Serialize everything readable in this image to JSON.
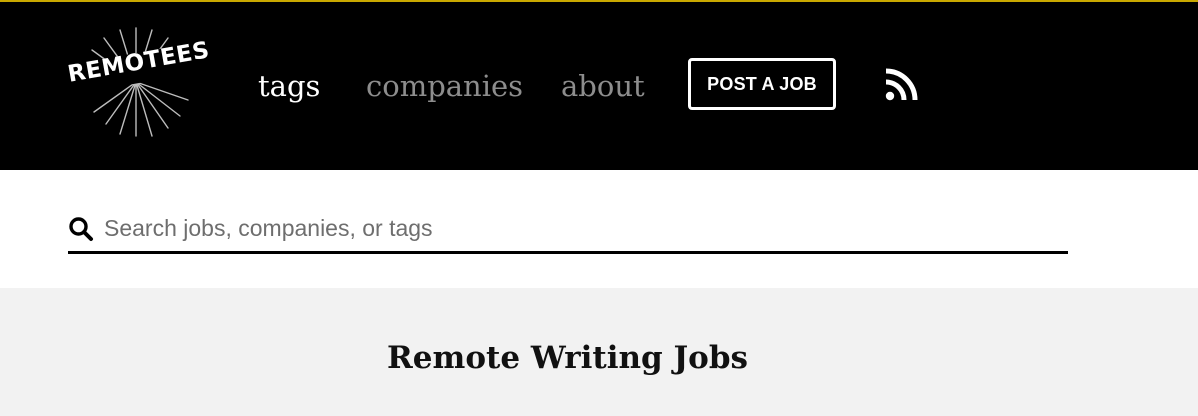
{
  "header": {
    "logo_text": "REMOTEES",
    "nav": [
      {
        "label": "tags"
      },
      {
        "label": "companies"
      },
      {
        "label": "about"
      }
    ],
    "post_job_label": "POST A JOB",
    "rss_icon": "rss-icon"
  },
  "search": {
    "placeholder": "Search jobs, companies, or tags",
    "value": "",
    "icon": "search-icon"
  },
  "main": {
    "title": "Remote Writing Jobs"
  },
  "colors": {
    "header_bg": "#000000",
    "accent_border": "#c9a800",
    "nav_active": "#ffffff",
    "nav_inactive": "#8d8d8d",
    "content_bg": "#f2f2f2"
  }
}
